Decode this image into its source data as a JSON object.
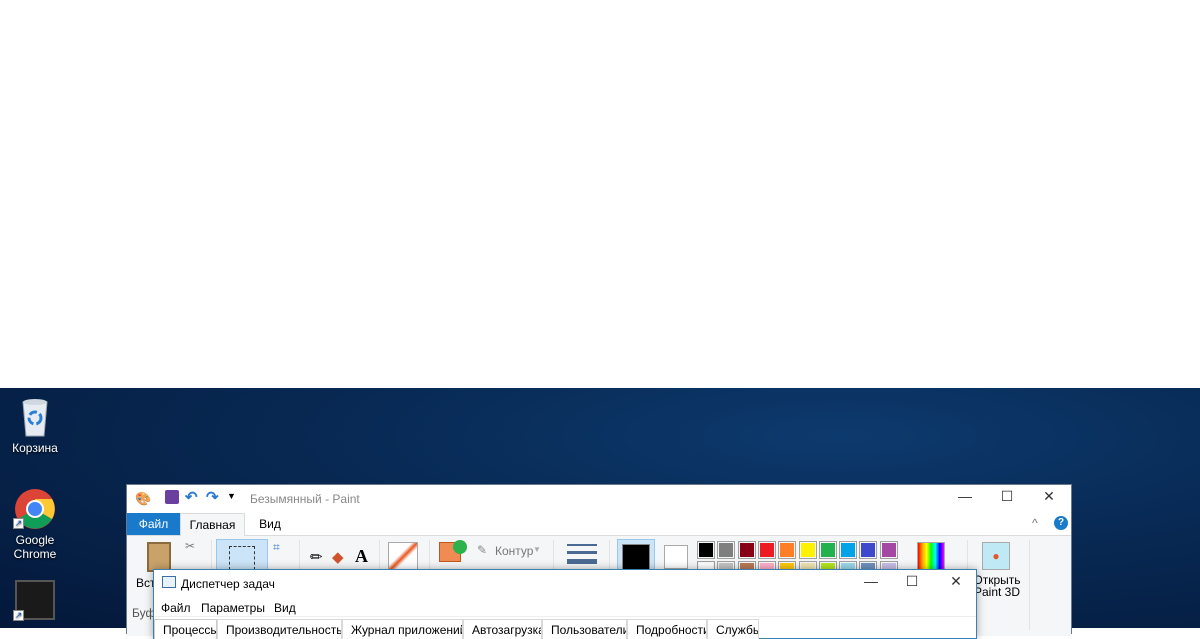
{
  "desktop": {
    "icons": [
      {
        "label": "Корзина",
        "icon": "recycle-bin-icon"
      },
      {
        "label": "Google Chrome",
        "icon": "chrome-icon"
      },
      {
        "label": "",
        "icon": "nvidia-geforce-icon"
      }
    ]
  },
  "paint": {
    "title": "Безымянный - Paint",
    "tabs": [
      {
        "label": "Файл",
        "active": false,
        "color": "#1979ca"
      },
      {
        "label": "Главная",
        "active": true
      },
      {
        "label": "Вид",
        "active": false
      }
    ],
    "ribbon": {
      "paste_label": "Вста",
      "clipboard_group": "Буф",
      "outline_label": "Контур",
      "open_paint3d": "Открыть Paint 3D"
    },
    "palette_row1": [
      "#000000",
      "#7f7f7f",
      "#880015",
      "#ed1c24",
      "#ff7f27",
      "#fff200",
      "#22b14c",
      "#00a2e8",
      "#3f48cc",
      "#a349a4"
    ],
    "palette_row2": [
      "#ffffff",
      "#c3c3c3",
      "#b97a57",
      "#ffaec9",
      "#ffc90e",
      "#efe4b0",
      "#b5e61d",
      "#99d9ea",
      "#7092be",
      "#c8bfe7"
    ],
    "color1": "#000000",
    "color2": "#ffffff"
  },
  "taskmgr": {
    "title": "Диспетчер задач",
    "menu": [
      "Файл",
      "Параметры",
      "Вид"
    ],
    "tabs": [
      "Процессы",
      "Производительность",
      "Журнал приложений",
      "Автозагрузка",
      "Пользователи",
      "Подробности",
      "Службы"
    ]
  }
}
